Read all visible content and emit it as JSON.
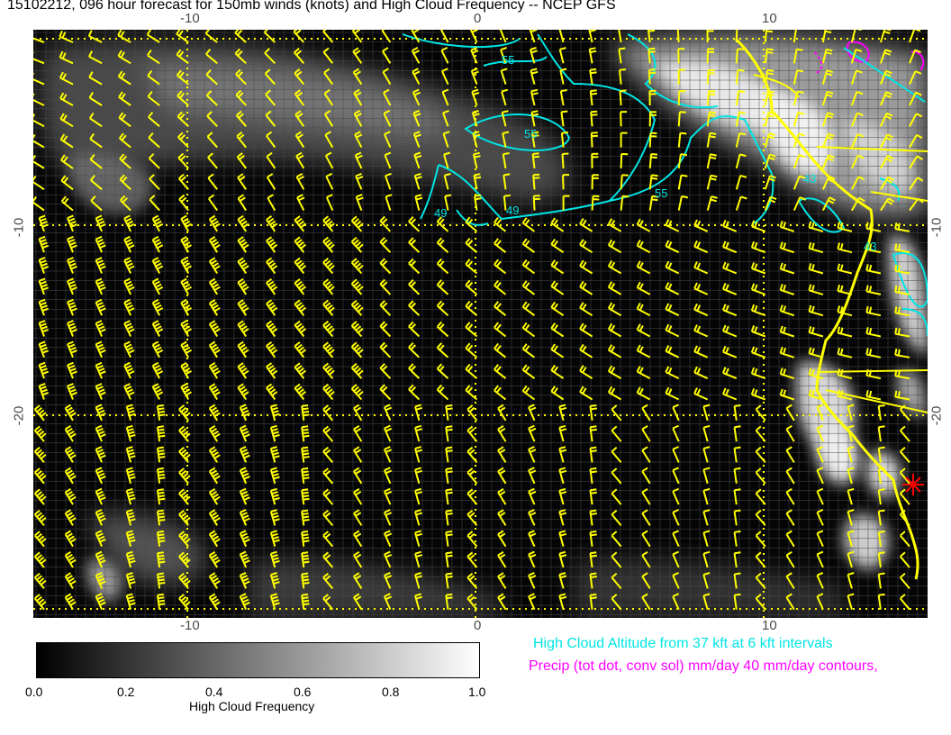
{
  "title": "15102212, 096 hour forecast for 150mb winds (knots) and High Cloud Frequency -- NCEP GFS",
  "axes": {
    "x_ticks_top": [
      "-10",
      "0",
      "10"
    ],
    "x_ticks_bottom": [
      "-10",
      "0",
      "10"
    ],
    "y_ticks_left": [
      "-10",
      "-20"
    ],
    "y_ticks_right": [
      "-10",
      "-20"
    ],
    "lon_range": [
      -15.5,
      15.5
    ],
    "lat_range": [
      -29,
      -1
    ]
  },
  "colorbar": {
    "label": "High Cloud Frequency",
    "ticks": [
      "0.0",
      "0.2",
      "0.4",
      "0.6",
      "0.8",
      "1.0"
    ],
    "colors": [
      "#000000",
      "#ffffff"
    ]
  },
  "legend": {
    "cloud_altitude": "High Cloud Altitude from 37 kft at 6 kft intervals",
    "precip": "Precip (tot dot, conv sol) mm/day 40 mm/day contours,"
  },
  "contour_labels": [
    "55",
    "55",
    "49",
    "55",
    "49",
    "43",
    "43"
  ],
  "colors": {
    "barb": "#ffff00",
    "coast": "#ffff00",
    "contour": "#00e5e5",
    "precip": "#ff00ff",
    "marker": "#ff0000",
    "grid": "#555555"
  }
}
